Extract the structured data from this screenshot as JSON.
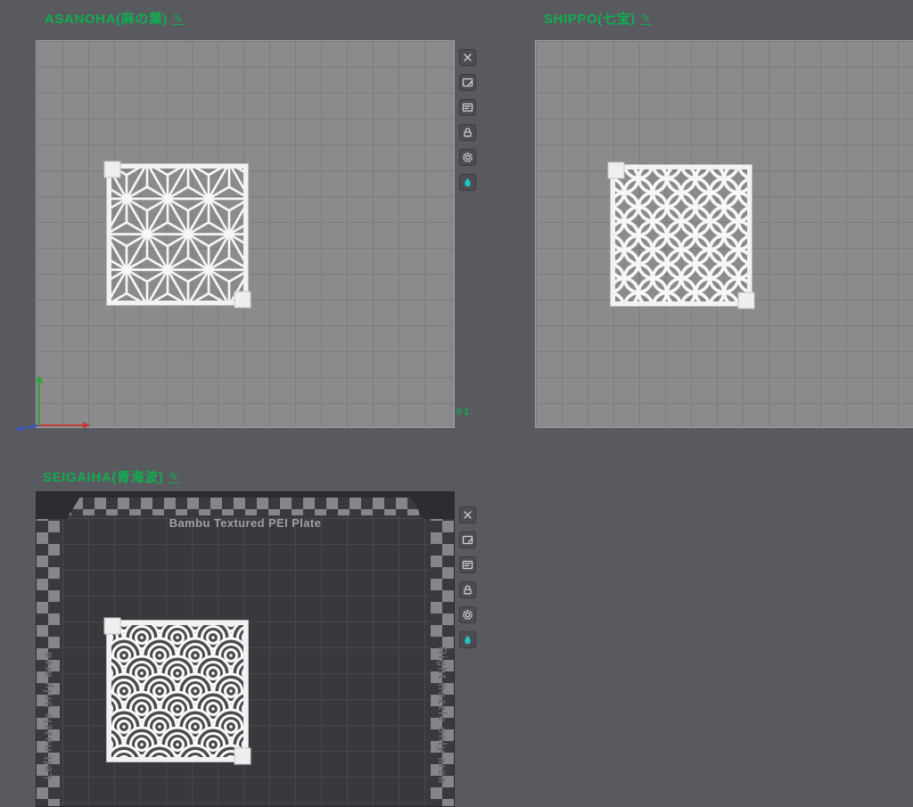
{
  "colors": {
    "title_green": "#10ae4f",
    "paint_teal": "#1fc3c6",
    "page_bg": "#595960",
    "plate_light": "#8b8b8d",
    "plate_dark": "#39393d",
    "axis_x": "#c03a34",
    "axis_y": "#2aa637",
    "axis_z": "#3a58c8"
  },
  "plates": [
    {
      "name": "asanoha",
      "title": "ASANOHA(麻の葉)",
      "number": "01"
    },
    {
      "name": "shippo",
      "title": "SHIPPO(七宝)"
    },
    {
      "name": "seigaiha",
      "title": "SEIGAIHA(青海波)",
      "plate_type_label": "Bambu Textured PEI Plate",
      "left_edge_label": "Left nozzle only area",
      "right_edge_label": "Right nozzle only area"
    }
  ],
  "plate_toolbar": {
    "icons": [
      {
        "name": "delete-plate",
        "glyph": "close-x"
      },
      {
        "name": "edit-plate",
        "glyph": "plate-pencil"
      },
      {
        "name": "rename-plate",
        "glyph": "plate-label"
      },
      {
        "name": "lock-plate",
        "glyph": "unlock"
      },
      {
        "name": "plate-settings",
        "glyph": "gear"
      },
      {
        "name": "paint-plate",
        "glyph": "paint-drop"
      }
    ]
  }
}
